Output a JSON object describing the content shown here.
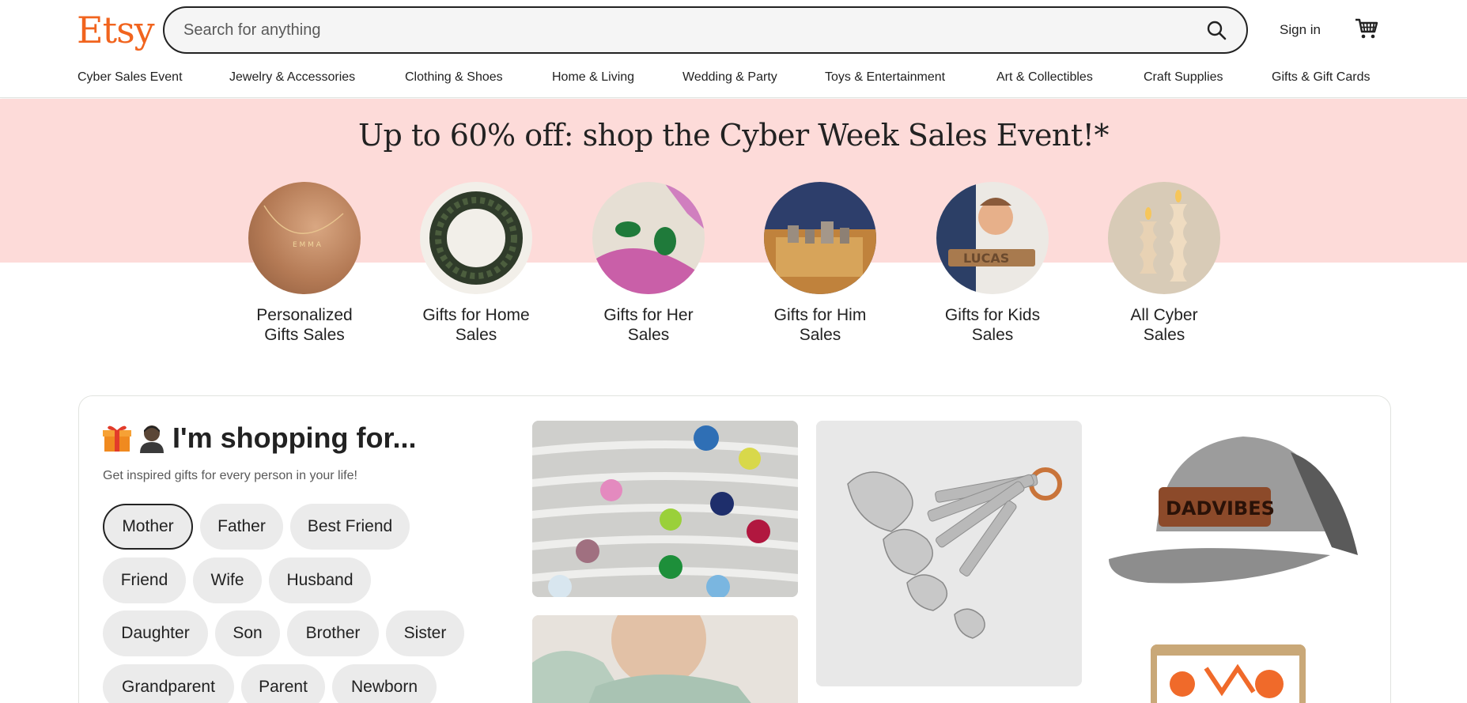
{
  "header": {
    "logo": "Etsy",
    "search_placeholder": "Search for anything",
    "sign_in": "Sign in"
  },
  "nav": [
    "Cyber Sales Event",
    "Jewelry & Accessories",
    "Clothing & Shoes",
    "Home & Living",
    "Wedding & Party",
    "Toys & Entertainment",
    "Art & Collectibles",
    "Craft Supplies",
    "Gifts & Gift Cards"
  ],
  "banner": {
    "title": "Up to 60% off: shop the Cyber Week Sales Event!*",
    "categories": [
      {
        "line1": "Personalized",
        "line2": "Gifts Sales"
      },
      {
        "line1": "Gifts for Home",
        "line2": "Sales"
      },
      {
        "line1": "Gifts for Her",
        "line2": "Sales"
      },
      {
        "line1": "Gifts for Him",
        "line2": "Sales"
      },
      {
        "line1": "Gifts for Kids",
        "line2": "Sales"
      },
      {
        "line1": "All Cyber",
        "line2": "Sales"
      }
    ]
  },
  "shopping_for": {
    "title": "I'm shopping for...",
    "subtitle": "Get inspired gifts for every person in your life!",
    "chips": [
      "Mother",
      "Father",
      "Best Friend",
      "Friend",
      "Wife",
      "Husband",
      "Daughter",
      "Son",
      "Brother",
      "Sister",
      "Grandparent",
      "Parent",
      "Newborn"
    ],
    "selected": "Mother"
  },
  "colors": {
    "brand": "#F1641E",
    "banner_bg": "#FDDBD9",
    "chip_bg": "#EBEBEB"
  },
  "icons": [
    "search-icon",
    "cart-icon",
    "gift-icon",
    "person-icon"
  ]
}
